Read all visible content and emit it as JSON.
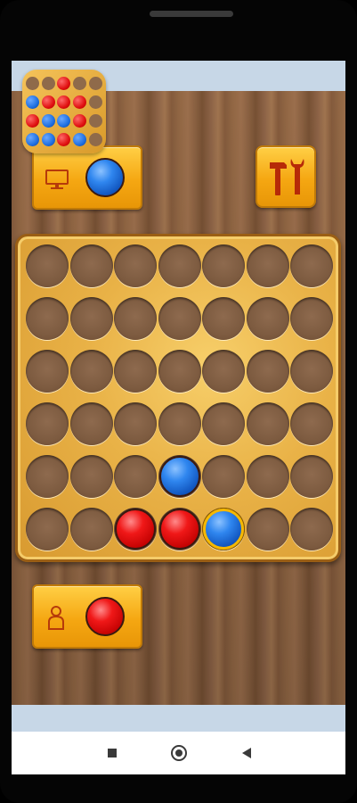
{
  "app": {
    "logo_icon": "connect-four-logo",
    "logo_pattern": [
      [
        "e",
        "e",
        "r",
        "e",
        "e"
      ],
      [
        "b",
        "r",
        "r",
        "r",
        "e"
      ],
      [
        "r",
        "b",
        "b",
        "r",
        "e"
      ],
      [
        "b",
        "b",
        "r",
        "b",
        "e"
      ]
    ]
  },
  "players": {
    "top": {
      "icon": "computer-icon",
      "token_color": "blue"
    },
    "bottom": {
      "icon": "person-icon",
      "token_color": "red"
    }
  },
  "toolbar": {
    "settings_icon": "hammer-wrench-icon"
  },
  "board": {
    "columns": 7,
    "rows": 6,
    "cells": [
      [
        "",
        "",
        "",
        "",
        "",
        "",
        ""
      ],
      [
        "",
        "",
        "",
        "",
        "",
        "",
        ""
      ],
      [
        "",
        "",
        "",
        "",
        "",
        "",
        ""
      ],
      [
        "",
        "",
        "",
        "",
        "",
        "",
        ""
      ],
      [
        "",
        "",
        "",
        "blue",
        "",
        "",
        ""
      ],
      [
        "",
        "",
        "red",
        "red",
        "blue",
        "",
        ""
      ]
    ],
    "last_move": {
      "row": 5,
      "col": 4
    }
  },
  "colors": {
    "red": "#e51414",
    "blue": "#1f6fe0",
    "panel": "#f5a712",
    "board": "#e9b247",
    "wood": "#94684a",
    "screen_bg": "#c7d7e7"
  },
  "navigation": {
    "recents_icon": "square-icon",
    "home_icon": "circle-home-icon",
    "back_icon": "triangle-back-icon"
  }
}
